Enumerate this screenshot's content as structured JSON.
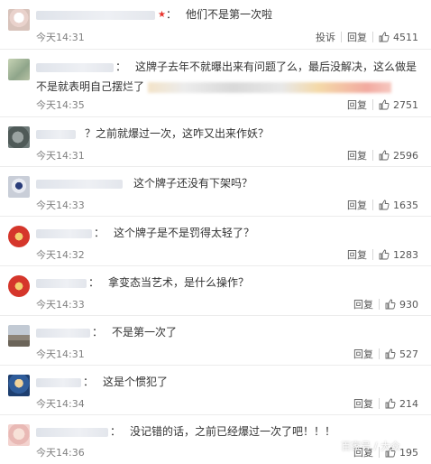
{
  "labels": {
    "reply": "回复",
    "report": "投诉",
    "colon": "："
  },
  "comments": [
    {
      "text": "他们不是第一次啦",
      "time": "今天14:31",
      "likes": "4511",
      "has_report": true,
      "avatar_color": "#e8ddd8"
    },
    {
      "text": "这牌子去年不就曝出来有问题了么，最后没解决，这么做是不是就表明自己摆烂了",
      "time": "今天14:35",
      "likes": "2751",
      "has_report": false,
      "avatar_color": "#a9b8a0"
    },
    {
      "text": "？之前就爆过一次，这咋又出来作妖？",
      "time": "今天14:31",
      "likes": "2596",
      "has_report": false,
      "avatar_color": "#6e7a78"
    },
    {
      "text": "这个牌子还没有下架吗？",
      "time": "今天14:33",
      "likes": "1635",
      "has_report": false,
      "avatar_color": "#d8dde6"
    },
    {
      "text": "这个牌子是不是罚得太轻了？",
      "time": "今天14:32",
      "likes": "1283",
      "has_report": false,
      "avatar_color": "#c83a2e"
    },
    {
      "text": "拿变态当艺术，是什么操作？",
      "time": "今天14:33",
      "likes": "930",
      "has_report": false,
      "avatar_color": "#c83a2e"
    },
    {
      "text": "不是第一次了",
      "time": "今天14:31",
      "likes": "527",
      "has_report": false,
      "avatar_color": "#8a8f96"
    },
    {
      "text": "这是个惯犯了",
      "time": "今天14:34",
      "likes": "214",
      "has_report": false,
      "avatar_color": "#3a6fb0"
    },
    {
      "text": "没记错的话，之前已经爆过一次了吧！！！",
      "time": "今天14:36",
      "likes": "195",
      "has_report": false,
      "avatar_color": "#f0c8c8"
    }
  ],
  "watermark": "百家号 / 大众"
}
